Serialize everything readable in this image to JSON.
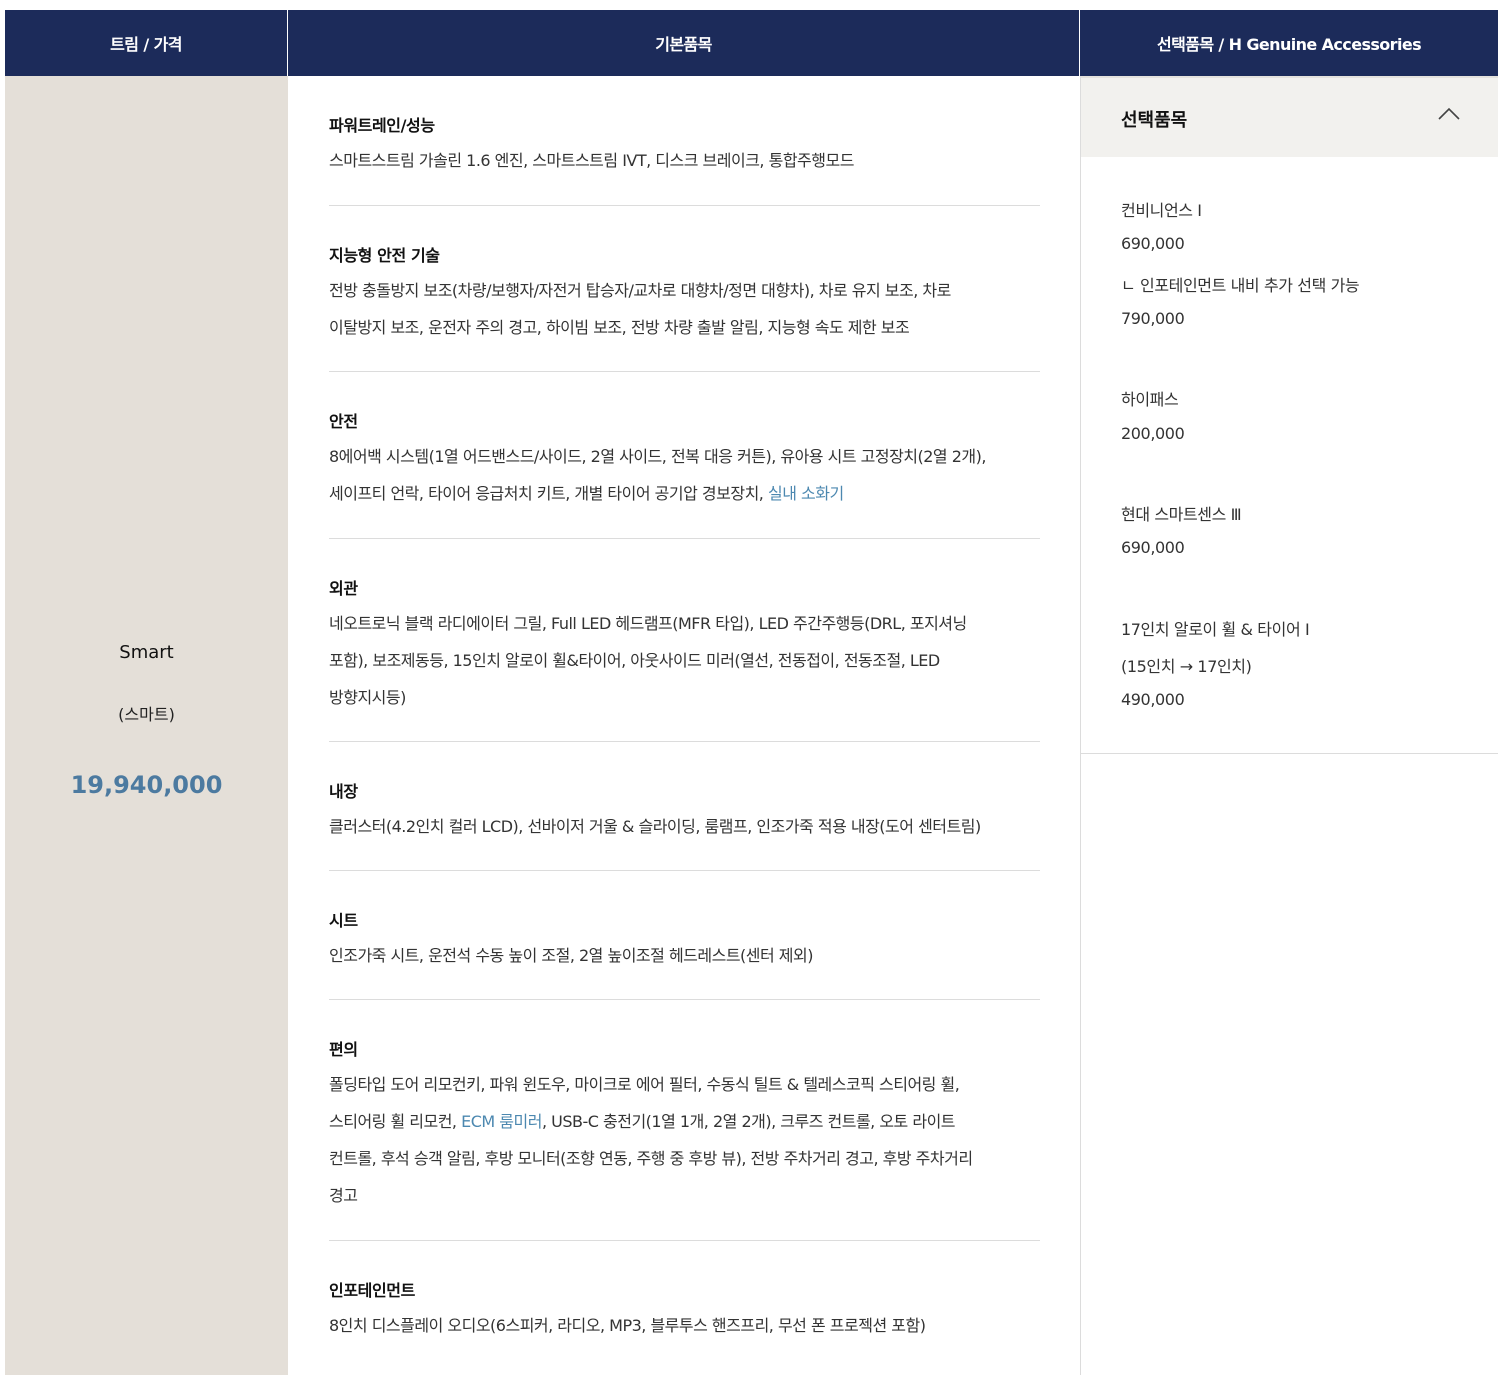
{
  "header": {
    "col_trim": "트림 / 가격",
    "col_basic": "기본품목",
    "col_options": "선택품목 / H Genuine Accessories"
  },
  "trim": {
    "name": "Smart",
    "sub": "(스마트)",
    "price": "19,940,000"
  },
  "basic_sections": [
    {
      "title": "파워트레인/성능",
      "lines": [
        "스마트스트림 가솔린 1.6 엔진, 스마트스트림 IVT, 디스크 브레이크, 통합주행모드"
      ]
    },
    {
      "title": "지능형 안전 기술",
      "lines": [
        "전방 충돌방지 보조(차량/보행자/자전거 탑승자/교차로 대향차/정면 대향차), 차로 유지 보조, 차로",
        "이탈방지 보조, 운전자 주의 경고, 하이빔 보조, 전방 차량 출발 알림, 지능형 속도 제한 보조"
      ]
    },
    {
      "title": "안전",
      "lines": [
        "8에어백 시스템(1열 어드밴스드/사이드, 2열 사이드, 전복 대응 커튼), 유아용 시트 고정장치(2열 2개),",
        "세이프티 언락, 타이어 응급처치 키트, 개별 타이어 공기압 경보장치, "
      ],
      "link": "실내 소화기"
    },
    {
      "title": "외관",
      "lines": [
        "네오트로닉 블랙 라디에이터 그릴, Full LED 헤드램프(MFR 타입), LED 주간주행등(DRL, 포지셔닝",
        "포함), 보조제동등, 15인치 알로이 휠&타이어, 아웃사이드 미러(열선, 전동접이, 전동조절, LED",
        "방향지시등)"
      ]
    },
    {
      "title": "내장",
      "lines": [
        "클러스터(4.2인치 컬러 LCD), 선바이저 거울 & 슬라이딩, 룸램프, 인조가죽 적용 내장(도어 센터트림)"
      ]
    },
    {
      "title": "시트",
      "lines": [
        "인조가죽 시트, 운전석 수동 높이 조절, 2열 높이조절 헤드레스트(센터 제외)"
      ]
    },
    {
      "title": "편의",
      "line1": "폴딩타입 도어 리모컨키, 파워 윈도우, 마이크로 에어 필터, 수동식 틸트 & 텔레스코픽 스티어링 휠,",
      "line2_pre": "스티어링 휠 리모컨, ",
      "line2_link": "ECM 룸미러",
      "line2_post": ", USB-C 충전기(1열 1개, 2열 2개), 크루즈 컨트롤, 오토 라이트",
      "line3": "컨트롤, 후석 승객 알림, 후방 모니터(조향 연동, 주행 중 후방 뷰), 전방 주차거리 경고, 후방 주차거리",
      "line4": "경고"
    },
    {
      "title": "인포테인먼트",
      "lines": [
        "8인치 디스플레이 오디오(6스피커, 라디오, MP3, 블루투스 핸즈프리, 무선 폰 프로젝션 포함)"
      ]
    }
  ],
  "options": {
    "title": "선택품목",
    "toggle_icon": "chevron-up-icon",
    "items": [
      "컨비니언스 Ⅰ",
      "690,000",
      "ㄴ 인포테인먼트 내비 추가 선택 가능",
      "790,000",
      "하이패스",
      "200,000",
      "현대 스마트센스 Ⅲ",
      "690,000",
      "17인치 알로이 휠 & 타이어 Ⅰ",
      "(15인치 → 17인치)",
      "490,000"
    ]
  },
  "colors": {
    "header_bg": "#1c2b5a",
    "trim_bg": "#e4dfd8",
    "price": "#4c7aa0",
    "link": "#4c88b0"
  }
}
